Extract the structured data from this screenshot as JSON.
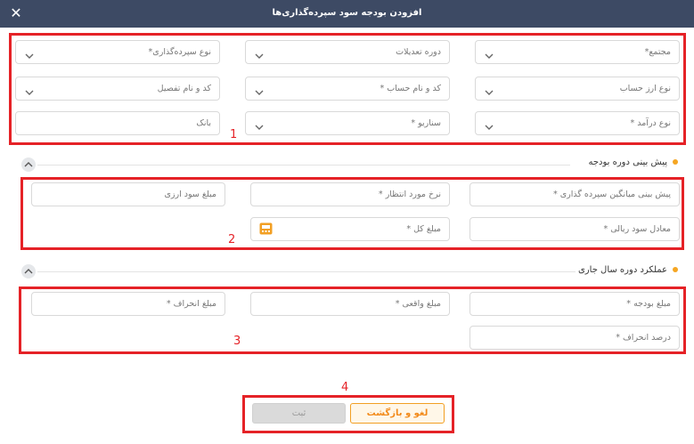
{
  "dialog": {
    "title": "افزودن بودجه سود سپرده‌گذاری‌ها",
    "close_glyph": "✕"
  },
  "filters": {
    "complex": "مجتمع*",
    "adjustment_period": "دوره تعدیلات",
    "deposit_type": "نوع سپرده‌گذاری*",
    "account_currency_type": "نوع ارز حساب",
    "account_code_name": "کد و نام حساب *",
    "detail_code_name": "کد و نام تفصیل",
    "income_type": "نوع درآمد *",
    "scenario": "سناریو *",
    "bank": "بانک"
  },
  "forecast": {
    "title": "پیش بینی دوره بودجه",
    "avg_deposit_forecast": "پیش بینی میانگین سپرده گذاری *",
    "expected_rate": "نرخ مورد انتظار *",
    "fx_profit_amount": "مبلغ سود ارزی",
    "rial_profit_equivalent": "معادل سود ریالی *",
    "total_amount": "مبلغ کل *"
  },
  "performance": {
    "title": "عملکرد دوره سال جاری",
    "budget_amount": "مبلغ بودجه *",
    "actual_amount": "مبلغ واقعی *",
    "deviation_amount": "مبلغ انحراف *",
    "deviation_percent": "درصد انحراف *"
  },
  "actions": {
    "cancel_back": "لغو و بازگشت",
    "submit": "ثبت"
  },
  "annotations": [
    "1",
    "2",
    "3",
    "4"
  ],
  "colors": {
    "header": "#3d4a64",
    "accent": "#f29f23",
    "annotation": "#e52227",
    "section_dot": "#f5a623"
  }
}
